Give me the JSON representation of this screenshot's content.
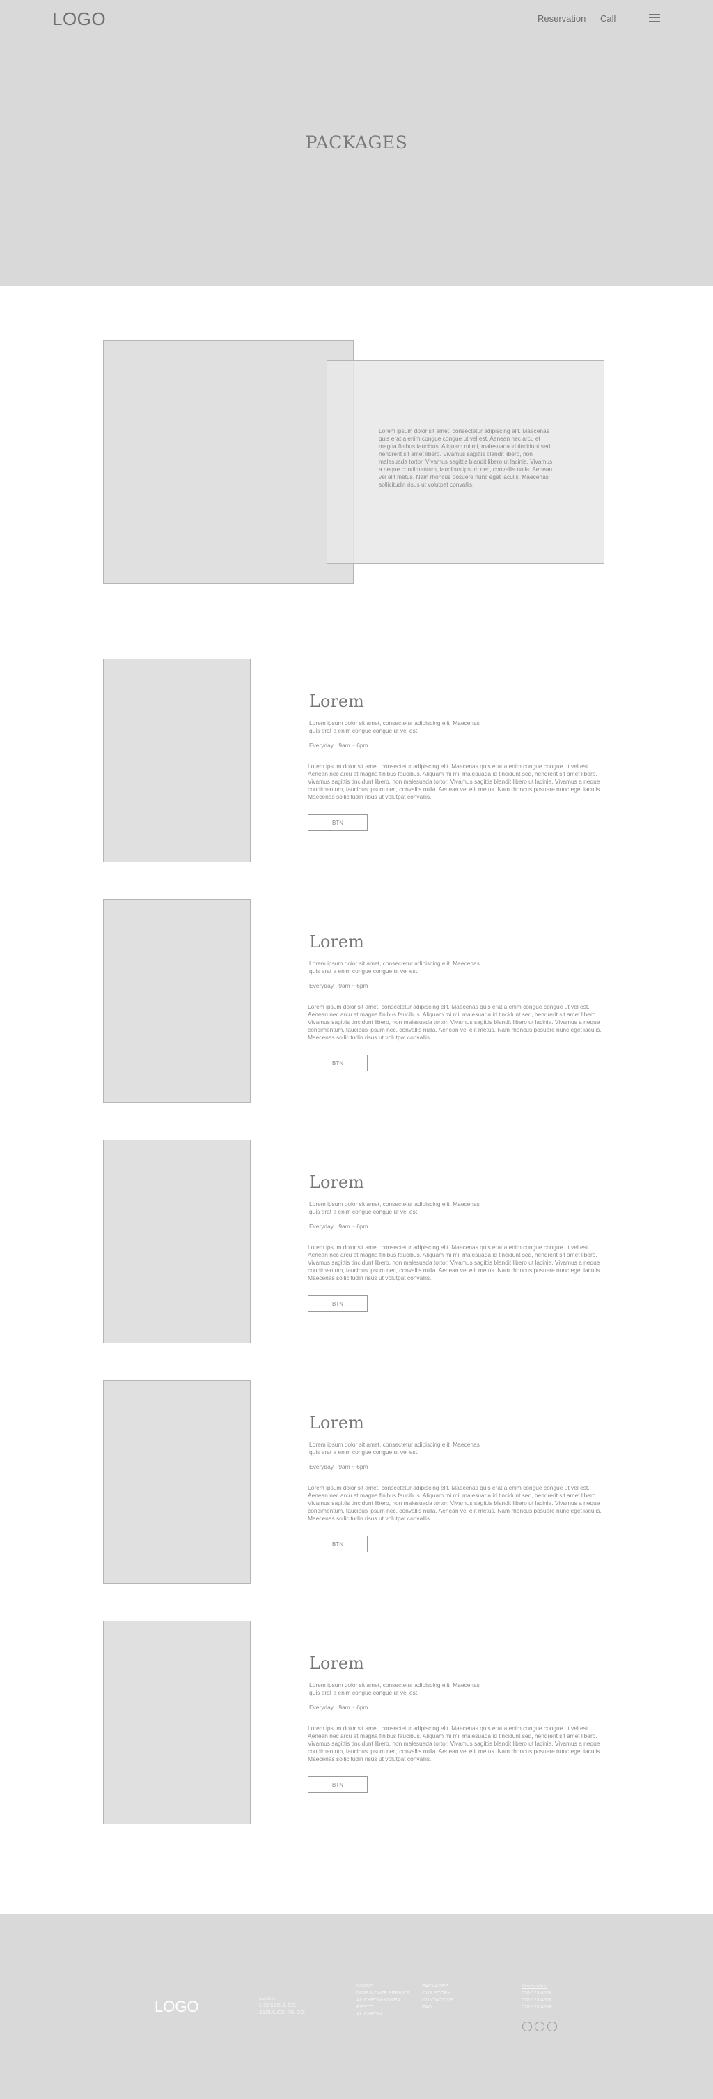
{
  "header": {
    "logo": "LOGO",
    "nav": [
      "Reservation",
      "Call"
    ],
    "menu_icon": "hamburger-menu-icon"
  },
  "hero": {
    "title": "PACKAGES"
  },
  "intro": {
    "text": "Lorem ipsum dolor sit amet, consectetur adipiscing elit. Maecenas quis erat a enim congue congue ut vel est. Aenean nec arcu et magna finibus faucibus. Aliquam mi mi, malesuada id tincidunt sed, hendrerit sit amet libero. Vivamus sagittis blandit libero, non malesuada tortor. Vivamus sagittis blandit libero ut lacinia. Vivamus a neque condimentum, faucibus ipsum nec, convallis nulla. Aenean vel elit metus. Nam rhoncus posuere nunc eget iaculis. Maecenas sollicitudin risus ut volutpat convallis."
  },
  "packages": [
    {
      "title": "Lorem",
      "subtitle": "Lorem ipsum dolor sit amet, consectetur adipiscing elit. Maecenas quis erat a enim congue congue ut vel est.",
      "hours": "Everyday · 9am ~ 6pm",
      "body": "Lorem ipsum dolor sit amet, consectetur adipiscing elit. Maecenas quis erat a enim congue congue ut vel est. Aenean nec arcu et magna finibus faucibus. Aliquam mi mi, malesuada id tincidunt sed, hendrerit sit amet libero. Vivamus sagittis tincidunt libero, non malesuada tortor. Vivamus sagittis blandit libero ut lacinia. Vivamus a neque condimentum, faucibus ipsum nec, convallis nulla. Aenean vel elit metus. Nam rhoncus posuere nunc eget iaculis. Maecenas sollicitudin risus ut volutpat convallis.",
      "button": "BTN"
    },
    {
      "title": "Lorem",
      "subtitle": "Lorem ipsum dolor sit amet, consectetur adipiscing elit. Maecenas quis erat a enim congue congue ut vel est.",
      "hours": "Everyday · 9am ~ 6pm",
      "body": "Lorem ipsum dolor sit amet, consectetur adipiscing elit. Maecenas quis erat a enim congue congue ut vel est. Aenean nec arcu et magna finibus faucibus. Aliquam mi mi, malesuada id tincidunt sed, hendrerit sit amet libero. Vivamus sagittis tincidunt libero, non malesuada tortor. Vivamus sagittis blandit libero ut lacinia. Vivamus a neque condimentum, faucibus ipsum nec, convallis nulla. Aenean vel elit metus. Nam rhoncus posuere nunc eget iaculis. Maecenas sollicitudin risus ut volutpat convallis.",
      "button": "BTN"
    },
    {
      "title": "Lorem",
      "subtitle": "Lorem ipsum dolor sit amet, consectetur adipiscing elit. Maecenas quis erat a enim congue congue ut vel est.",
      "hours": "Everyday · 9am ~ 6pm",
      "body": "Lorem ipsum dolor sit amet, consectetur adipiscing elit. Maecenas quis erat a enim congue congue ut vel est. Aenean nec arcu et magna finibus faucibus. Aliquam mi mi, malesuada id tincidunt sed, hendrerit sit amet libero. Vivamus sagittis tincidunt libero, non malesuada tortor. Vivamus sagittis blandit libero ut lacinia. Vivamus a neque condimentum, faucibus ipsum nec, convallis nulla. Aenean vel elit metus. Nam rhoncus posuere nunc eget iaculis. Maecenas sollicitudin risus ut volutpat convallis.",
      "button": "BTN"
    },
    {
      "title": "Lorem",
      "subtitle": "Lorem ipsum dolor sit amet, consectetur adipiscing elit. Maecenas quis erat a enim congue congue ut vel est.",
      "hours": "Everyday · 9am ~ 6pm",
      "body": "Lorem ipsum dolor sit amet, consectetur adipiscing elit. Maecenas quis erat a enim congue congue ut vel est. Aenean nec arcu et magna finibus faucibus. Aliquam mi mi, malesuada id tincidunt sed, hendrerit sit amet libero. Vivamus sagittis tincidunt libero, non malesuada tortor. Vivamus sagittis blandit libero ut lacinia. Vivamus a neque condimentum, faucibus ipsum nec, convallis nulla. Aenean vel elit metus. Nam rhoncus posuere nunc eget iaculis. Maecenas sollicitudin risus ut volutpat convallis.",
      "button": "BTN"
    },
    {
      "title": "Lorem",
      "subtitle": "Lorem ipsum dolor sit amet, consectetur adipiscing elit. Maecenas quis erat a enim congue congue ut vel est.",
      "hours": "Everyday · 9am ~ 6pm",
      "body": "Lorem ipsum dolor sit amet, consectetur adipiscing elit. Maecenas quis erat a enim congue congue ut vel est. Aenean nec arcu et magna finibus faucibus. Aliquam mi mi, malesuada id tincidunt sed, hendrerit sit amet libero. Vivamus sagittis tincidunt libero, non malesuada tortor. Vivamus sagittis blandit libero ut lacinia. Vivamus a neque condimentum, faucibus ipsum nec, convallis nulla. Aenean vel elit metus. Nam rhoncus posuere nunc eget iaculis. Maecenas sollicitudin risus ut volutpat convallis.",
      "button": "BTN"
    }
  ],
  "footer": {
    "logo": "LOGO",
    "address": [
      "SEOUL",
      "1-23 SEOUL CO.",
      "SEOUL-CO. PR. CO."
    ],
    "col1": [
      "DINING",
      "DINE & CAFE SERVICE",
      "AL-CHEON-KOREA",
      "RESTO",
      "AL-CHEON"
    ],
    "col2": [
      "PACKAGES",
      "OUR STORY",
      "CONTACT US",
      "FAQ"
    ],
    "contact_title": "Reservation",
    "contact": [
      "070-123-4568",
      "070-123-4568",
      "070-123-4568"
    ],
    "social_icons": [
      "social-icon-1",
      "social-icon-2",
      "social-icon-3"
    ]
  }
}
